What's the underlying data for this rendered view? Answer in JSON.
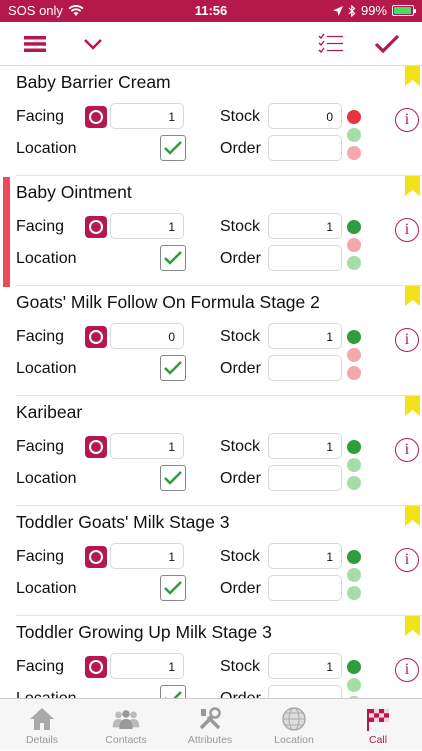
{
  "status": {
    "carrier": "SOS only",
    "time": "11:56",
    "battery": "99%"
  },
  "toolbar": {
    "menu_icon": "hamburger-icon",
    "dropdown_icon": "chevron-down-icon",
    "checklist_icon": "checklist-icon",
    "confirm_icon": "checkmark-icon"
  },
  "labels": {
    "facing": "Facing",
    "stock": "Stock",
    "location": "Location",
    "order": "Order"
  },
  "colors": {
    "brand": "#b5194b",
    "flag": "#f1e21a",
    "alert": "#ee4a5c"
  },
  "products": [
    {
      "name": "Baby Barrier Cream",
      "facing": "1",
      "stock": "0",
      "order": "",
      "lights": [
        "#e8353c",
        "#a6dca6",
        "#f3a8ad"
      ],
      "location_checked": true,
      "alert": false
    },
    {
      "name": "Baby Ointment",
      "facing": "1",
      "stock": "1",
      "order": "",
      "lights": [
        "#2e9e3c",
        "#f3a8ad",
        "#a6dca6"
      ],
      "location_checked": true,
      "alert": true
    },
    {
      "name": "Goats' Milk Follow On Formula Stage 2",
      "facing": "0",
      "stock": "1",
      "order": "",
      "lights": [
        "#2e9e3c",
        "#f3a8ad",
        "#f3a8ad"
      ],
      "location_checked": true,
      "alert": true
    },
    {
      "name": "Karibear",
      "facing": "1",
      "stock": "1",
      "order": "",
      "lights": [
        "#2e9e3c",
        "#a6dca6",
        "#a6dca6"
      ],
      "location_checked": true,
      "alert": false
    },
    {
      "name": "Toddler Goats' Milk Stage 3",
      "facing": "1",
      "stock": "1",
      "order": "",
      "lights": [
        "#2e9e3c",
        "#a6dca6",
        "#a6dca6"
      ],
      "location_checked": true,
      "alert": false
    },
    {
      "name": "Toddler Growing Up Milk Stage 3",
      "facing": "1",
      "stock": "1",
      "order": "",
      "lights": [
        "#2e9e3c",
        "#a6dca6",
        "#a6dca6"
      ],
      "location_checked": true,
      "alert": false
    }
  ],
  "tabs": [
    {
      "label": "Details",
      "icon": "house-icon",
      "active": false
    },
    {
      "label": "Contacts",
      "icon": "people-icon",
      "active": false
    },
    {
      "label": "Attributes",
      "icon": "tools-icon",
      "active": false
    },
    {
      "label": "Location",
      "icon": "globe-icon",
      "active": false
    },
    {
      "label": "Call",
      "icon": "checkered-flag-icon",
      "active": true
    }
  ]
}
